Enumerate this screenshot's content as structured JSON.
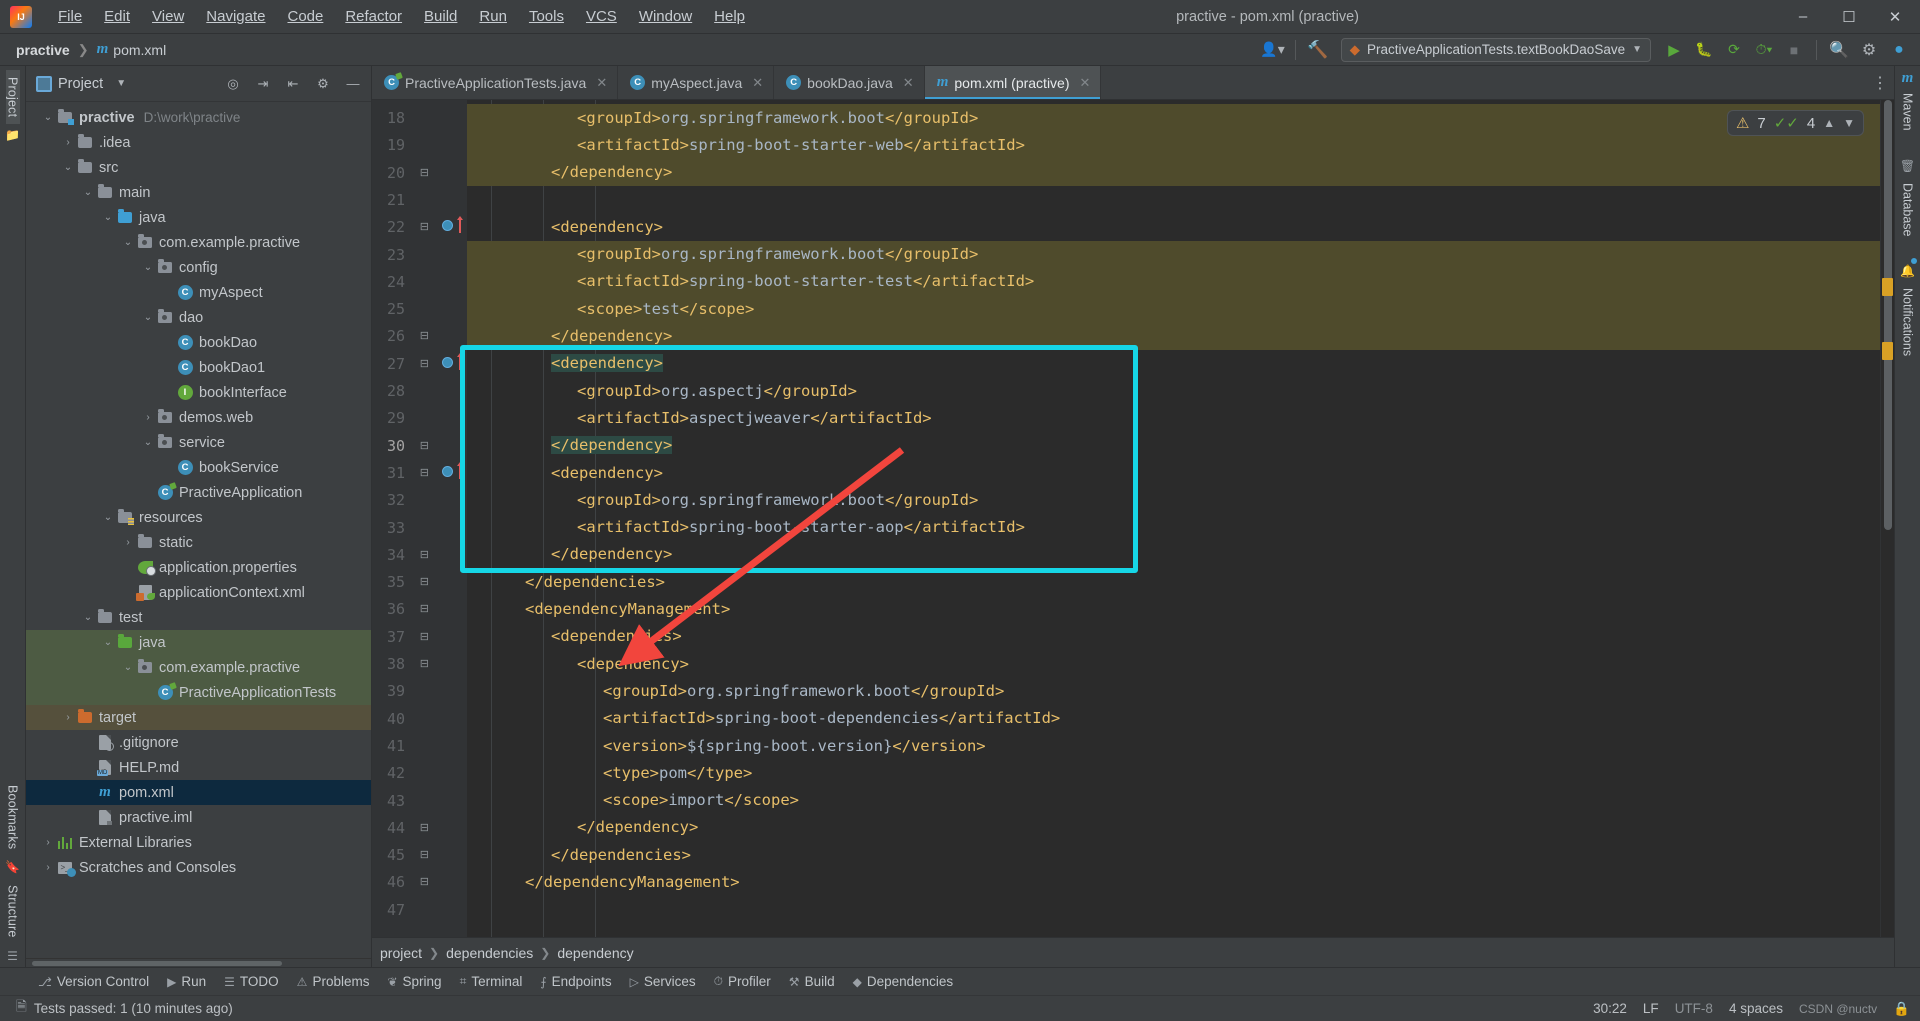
{
  "window": {
    "title": "practive - pom.xml (practive)",
    "logo_icon": "intellij-logo-icon",
    "minimize_icon": "minimize-icon",
    "maximize_icon": "maximize-icon",
    "close_icon": "close-icon"
  },
  "menubar": [
    {
      "label": "File"
    },
    {
      "label": "Edit"
    },
    {
      "label": "View"
    },
    {
      "label": "Navigate"
    },
    {
      "label": "Code"
    },
    {
      "label": "Refactor"
    },
    {
      "label": "Build"
    },
    {
      "label": "Run"
    },
    {
      "label": "Tools"
    },
    {
      "label": "VCS"
    },
    {
      "label": "Window"
    },
    {
      "label": "Help"
    }
  ],
  "navbar": {
    "project": "practive",
    "file": "pom.xml",
    "file_icon": "maven-m-icon",
    "run_config": "PractiveApplicationTests.textBookDaoSave",
    "run_config_icon": "run-config-icon",
    "dropdown_icon": "chevron-down-icon",
    "buttons": [
      {
        "name": "user-settings-icon"
      },
      {
        "name": "build-hammer-icon"
      },
      {
        "name": "run-icon"
      },
      {
        "name": "debug-icon"
      },
      {
        "name": "run-with-coverage-icon"
      },
      {
        "name": "profiler-icon"
      },
      {
        "name": "stop-icon"
      },
      {
        "name": "search-everywhere-icon"
      },
      {
        "name": "settings-gear-icon"
      },
      {
        "name": "ide-assistant-icon"
      }
    ]
  },
  "left_rail": [
    {
      "label": "Project",
      "active": true
    },
    {
      "label": "Bookmarks",
      "active": false
    },
    {
      "label": "Structure",
      "active": false
    }
  ],
  "right_rail": [
    {
      "label": "Maven",
      "icon": "maven-m-icon"
    },
    {
      "label": "Database",
      "icon": "database-icon"
    },
    {
      "label": "Notifications",
      "icon": "bell-icon"
    }
  ],
  "project_panel": {
    "title": "Project",
    "title_icon": "project-view-icon",
    "dropdown_icon": "chevron-down-icon",
    "actions": [
      {
        "name": "scroll-from-source-icon"
      },
      {
        "name": "expand-all-icon"
      },
      {
        "name": "collapse-all-icon"
      },
      {
        "name": "settings-gear-icon"
      },
      {
        "name": "hide-panel-icon"
      }
    ],
    "tree": [
      {
        "depth": 0,
        "label": "practive",
        "sub": "D:\\work\\practive",
        "arrow": "down",
        "icon": "module-folder-icon",
        "bold": true
      },
      {
        "depth": 1,
        "label": ".idea",
        "arrow": "right",
        "icon": "folder-icon"
      },
      {
        "depth": 1,
        "label": "src",
        "arrow": "down",
        "icon": "folder-icon"
      },
      {
        "depth": 2,
        "label": "main",
        "arrow": "down",
        "icon": "folder-icon"
      },
      {
        "depth": 3,
        "label": "java",
        "arrow": "down",
        "icon": "source-root-folder-icon"
      },
      {
        "depth": 4,
        "label": "com.example.practive",
        "arrow": "down",
        "icon": "package-icon"
      },
      {
        "depth": 5,
        "label": "config",
        "arrow": "down",
        "icon": "package-icon"
      },
      {
        "depth": 6,
        "label": "myAspect",
        "arrow": "none",
        "icon": "java-class-icon"
      },
      {
        "depth": 5,
        "label": "dao",
        "arrow": "down",
        "icon": "package-icon"
      },
      {
        "depth": 6,
        "label": "bookDao",
        "arrow": "none",
        "icon": "java-class-icon"
      },
      {
        "depth": 6,
        "label": "bookDao1",
        "arrow": "none",
        "icon": "java-class-icon"
      },
      {
        "depth": 6,
        "label": "bookInterface",
        "arrow": "none",
        "icon": "java-interface-icon"
      },
      {
        "depth": 5,
        "label": "demos.web",
        "arrow": "right",
        "icon": "package-icon"
      },
      {
        "depth": 5,
        "label": "service",
        "arrow": "down",
        "icon": "package-icon"
      },
      {
        "depth": 6,
        "label": "bookService",
        "arrow": "none",
        "icon": "java-class-icon"
      },
      {
        "depth": 5,
        "label": "PractiveApplication",
        "arrow": "none",
        "icon": "spring-boot-class-icon"
      },
      {
        "depth": 3,
        "label": "resources",
        "arrow": "down",
        "icon": "resources-folder-icon"
      },
      {
        "depth": 4,
        "label": "static",
        "arrow": "right",
        "icon": "folder-icon"
      },
      {
        "depth": 4,
        "label": "application.properties",
        "arrow": "none",
        "icon": "spring-properties-icon"
      },
      {
        "depth": 4,
        "label": "applicationContext.xml",
        "arrow": "none",
        "icon": "spring-context-xml-icon"
      },
      {
        "depth": 2,
        "label": "test",
        "arrow": "down",
        "icon": "folder-icon"
      },
      {
        "depth": 3,
        "label": "java",
        "arrow": "down",
        "icon": "test-source-root-folder-icon",
        "highlight": "green"
      },
      {
        "depth": 4,
        "label": "com.example.practive",
        "arrow": "down",
        "icon": "package-icon",
        "highlight": "green"
      },
      {
        "depth": 5,
        "label": "PractiveApplicationTests",
        "arrow": "none",
        "icon": "spring-test-class-icon",
        "highlight": "green"
      },
      {
        "depth": 1,
        "label": "target",
        "arrow": "right",
        "icon": "excluded-folder-icon",
        "highlight": "brown"
      },
      {
        "depth": 2,
        "label": ".gitignore",
        "arrow": "none",
        "icon": "gitignore-file-icon"
      },
      {
        "depth": 2,
        "label": "HELP.md",
        "arrow": "none",
        "icon": "markdown-file-icon"
      },
      {
        "depth": 2,
        "label": "pom.xml",
        "arrow": "none",
        "icon": "maven-m-icon",
        "highlight": "blue"
      },
      {
        "depth": 2,
        "label": "practive.iml",
        "arrow": "none",
        "icon": "iml-file-icon"
      },
      {
        "depth": 0,
        "label": "External Libraries",
        "arrow": "right",
        "icon": "libraries-icon"
      },
      {
        "depth": 0,
        "label": "Scratches and Consoles",
        "arrow": "right",
        "icon": "scratches-icon"
      }
    ]
  },
  "editor": {
    "tabs": [
      {
        "label": "PractiveApplicationTests.java",
        "icon": "spring-test-class-icon",
        "active": false,
        "close_icon": "close-icon"
      },
      {
        "label": "myAspect.java",
        "icon": "java-class-icon",
        "active": false,
        "close_icon": "close-icon"
      },
      {
        "label": "bookDao.java",
        "icon": "java-class-icon",
        "active": false,
        "close_icon": "close-icon"
      },
      {
        "label": "pom.xml (practive)",
        "icon": "maven-m-icon",
        "active": true,
        "close_icon": "close-icon"
      }
    ],
    "tabs_menu_icon": "more-options-icon",
    "first_line": 18,
    "lines": [
      {
        "n": 18,
        "indent": 3,
        "text": "<groupId>org.springframework.boot</groupId>",
        "hl": true
      },
      {
        "n": 19,
        "indent": 3,
        "text": "<artifactId>spring-boot-starter-web</artifactId>",
        "hl": true
      },
      {
        "n": 20,
        "indent": 2,
        "text": "</dependency>",
        "hl": true,
        "fold": "end"
      },
      {
        "n": 21,
        "indent": 0,
        "text": ""
      },
      {
        "n": 22,
        "indent": 2,
        "text": "<dependency>",
        "fold": "start",
        "breakpoint": true
      },
      {
        "n": 23,
        "indent": 3,
        "text": "<groupId>org.springframework.boot</groupId>",
        "hl": true
      },
      {
        "n": 24,
        "indent": 3,
        "text": "<artifactId>spring-boot-starter-test</artifactId>",
        "hl": true
      },
      {
        "n": 25,
        "indent": 3,
        "text": "<scope>test</scope>",
        "hl": true
      },
      {
        "n": 26,
        "indent": 2,
        "text": "</dependency>",
        "hl": true,
        "fold": "end"
      },
      {
        "n": 27,
        "indent": 2,
        "text": "<dependency>",
        "fold": "start",
        "breakpoint": true,
        "selected": true
      },
      {
        "n": 28,
        "indent": 3,
        "text": "<groupId>org.aspectj</groupId>"
      },
      {
        "n": 29,
        "indent": 3,
        "text": "<artifactId>aspectjweaver</artifactId>"
      },
      {
        "n": 30,
        "indent": 2,
        "text": "</dependency>",
        "fold": "end",
        "selected": true,
        "current": true
      },
      {
        "n": 31,
        "indent": 2,
        "text": "<dependency>",
        "fold": "start",
        "breakpoint": true
      },
      {
        "n": 32,
        "indent": 3,
        "text": "<groupId>org.springframework.boot</groupId>"
      },
      {
        "n": 33,
        "indent": 3,
        "text": "<artifactId>spring-boot-starter-aop</artifactId>"
      },
      {
        "n": 34,
        "indent": 2,
        "text": "</dependency>",
        "fold": "end"
      },
      {
        "n": 35,
        "indent": 1,
        "text": "</dependencies>",
        "fold": "end"
      },
      {
        "n": 36,
        "indent": 1,
        "text": "<dependencyManagement>",
        "fold": "start"
      },
      {
        "n": 37,
        "indent": 2,
        "text": "<dependencies>",
        "fold": "start"
      },
      {
        "n": 38,
        "indent": 3,
        "text": "<dependency>",
        "fold": "start"
      },
      {
        "n": 39,
        "indent": 4,
        "text": "<groupId>org.springframework.boot</groupId>"
      },
      {
        "n": 40,
        "indent": 4,
        "text": "<artifactId>spring-boot-dependencies</artifactId>"
      },
      {
        "n": 41,
        "indent": 4,
        "text": "<version>${spring-boot.version}</version>"
      },
      {
        "n": 42,
        "indent": 4,
        "text": "<type>pom</type>"
      },
      {
        "n": 43,
        "indent": 4,
        "text": "<scope>import</scope>"
      },
      {
        "n": 44,
        "indent": 3,
        "text": "</dependency>",
        "fold": "end"
      },
      {
        "n": 45,
        "indent": 2,
        "text": "</dependencies>",
        "fold": "end"
      },
      {
        "n": 46,
        "indent": 1,
        "text": "</dependencyManagement>",
        "fold": "end"
      },
      {
        "n": 47,
        "indent": 0,
        "text": ""
      }
    ],
    "inspection": {
      "warning_icon": "warning-triangle-icon",
      "warning_count": "7",
      "ok_icon": "inspection-ok-icon",
      "ok_count": "4",
      "prev_icon": "chevron-up-icon",
      "next_icon": "chevron-down-icon"
    },
    "breadcrumb": [
      "project",
      "dependencies",
      "dependency"
    ]
  },
  "annotations": {
    "highlight_color": "#16d6e6",
    "arrow_color": "#f2453d"
  },
  "bottom_tools": [
    {
      "label": "Version Control",
      "icon": "branch-icon"
    },
    {
      "label": "Run",
      "icon": "run-icon"
    },
    {
      "label": "TODO",
      "icon": "todo-list-icon"
    },
    {
      "label": "Problems",
      "icon": "problems-icon"
    },
    {
      "label": "Spring",
      "icon": "spring-leaf-icon"
    },
    {
      "label": "Terminal",
      "icon": "terminal-icon"
    },
    {
      "label": "Endpoints",
      "icon": "endpoints-icon"
    },
    {
      "label": "Services",
      "icon": "services-icon"
    },
    {
      "label": "Profiler",
      "icon": "profiler-icon"
    },
    {
      "label": "Build",
      "icon": "build-hammer-icon"
    },
    {
      "label": "Dependencies",
      "icon": "dependencies-icon"
    }
  ],
  "statusbar": {
    "message_icon": "event-log-icon",
    "message": "Tests passed: 1 (10 minutes ago)",
    "caret": "30:22",
    "line_separator": "LF",
    "encoding": "UTF-8",
    "indent": "4 spaces",
    "watermark": "CSDN @nuctv",
    "lock_icon": "readonly-toggle-icon"
  }
}
